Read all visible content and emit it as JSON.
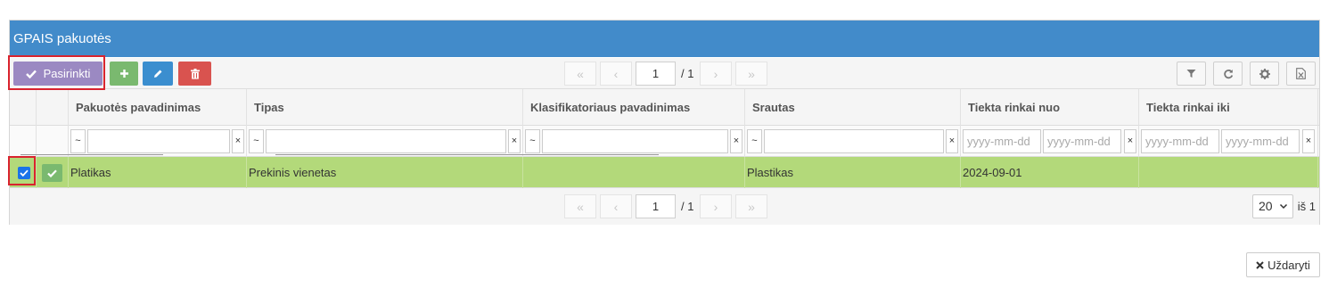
{
  "panel": {
    "title": "GPAIS pakuotės"
  },
  "toolbar": {
    "select_label": "Pasirinkti",
    "add_icon": "plus-icon",
    "edit_icon": "pencil-icon",
    "delete_icon": "trash-icon",
    "tools": [
      "filter-icon",
      "refresh-icon",
      "gear-icon",
      "excel-export-icon"
    ]
  },
  "pager": {
    "first": "«",
    "prev": "‹",
    "next": "›",
    "last": "»",
    "page": "1",
    "total": "/ 1"
  },
  "columns": [
    "Pakuotės pavadinimas",
    "Tipas",
    "Klasifikatoriaus pavadinimas",
    "Srautas",
    "Tiekta rinkai nuo",
    "Tiekta rinkai iki"
  ],
  "filters": {
    "op": "~",
    "clear": "×",
    "date_placeholder": "yyyy-mm-dd"
  },
  "rows": [
    {
      "name": "Platikas",
      "type": "Prekinis vienetas",
      "classifier": "",
      "stream": "Plastikas",
      "from": "2024-09-01",
      "to": "",
      "selected": true
    }
  ],
  "footer": {
    "page_size": "20",
    "of": "iš 1"
  },
  "close_label": "Uždaryti",
  "colors": {
    "header": "#428bca",
    "selected_row": "#b3d97a",
    "select_btn": "#9b89c2",
    "highlight": "#d9232e"
  }
}
